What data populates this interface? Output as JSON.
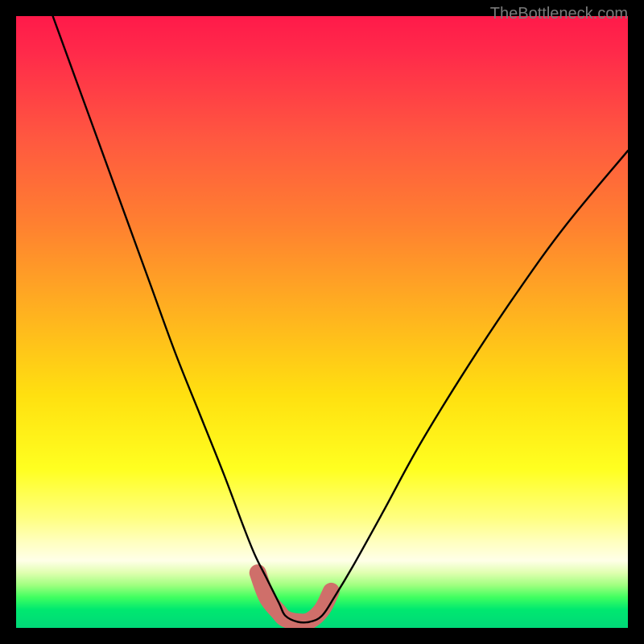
{
  "watermark": "TheBottleneck.com",
  "chart_data": {
    "type": "line",
    "title": "",
    "xlabel": "",
    "ylabel": "",
    "xlim": [
      0,
      100
    ],
    "ylim": [
      0,
      100
    ],
    "note": "Axes are not labeled in the image; values are normalized 0–100 estimates read from pixel positions. The curve appears to be a bottleneck curve: a smooth V dipping to ~0 near x≈44–48, with a thick salmon marker band along the valley floor.",
    "series": [
      {
        "name": "curve",
        "stroke": "#000000",
        "x": [
          6,
          10,
          14,
          18,
          22,
          26,
          30,
          34,
          37,
          39,
          41,
          43,
          44,
          46,
          48,
          50,
          52,
          55,
          60,
          66,
          74,
          82,
          90,
          100
        ],
        "values": [
          100,
          89,
          78,
          67,
          56,
          45,
          35,
          25,
          17,
          12,
          8,
          4,
          2,
          1,
          1,
          2,
          5,
          10,
          19,
          30,
          43,
          55,
          66,
          78
        ]
      },
      {
        "name": "marker-band",
        "stroke": "#cf6f6a",
        "x": [
          39.5,
          41,
          43,
          44,
          46,
          48,
          50,
          51.5
        ],
        "values": [
          9,
          5,
          2.5,
          1.5,
          1,
          1.2,
          3,
          6
        ]
      }
    ],
    "background_gradient": {
      "direction": "vertical",
      "stops": [
        {
          "pos": 0.0,
          "color": "#ff1a4a"
        },
        {
          "pos": 0.2,
          "color": "#ff5840"
        },
        {
          "pos": 0.48,
          "color": "#ffb020"
        },
        {
          "pos": 0.74,
          "color": "#ffff20"
        },
        {
          "pos": 0.89,
          "color": "#ffffe8"
        },
        {
          "pos": 0.95,
          "color": "#40ff60"
        },
        {
          "pos": 1.0,
          "color": "#00d878"
        }
      ]
    }
  }
}
